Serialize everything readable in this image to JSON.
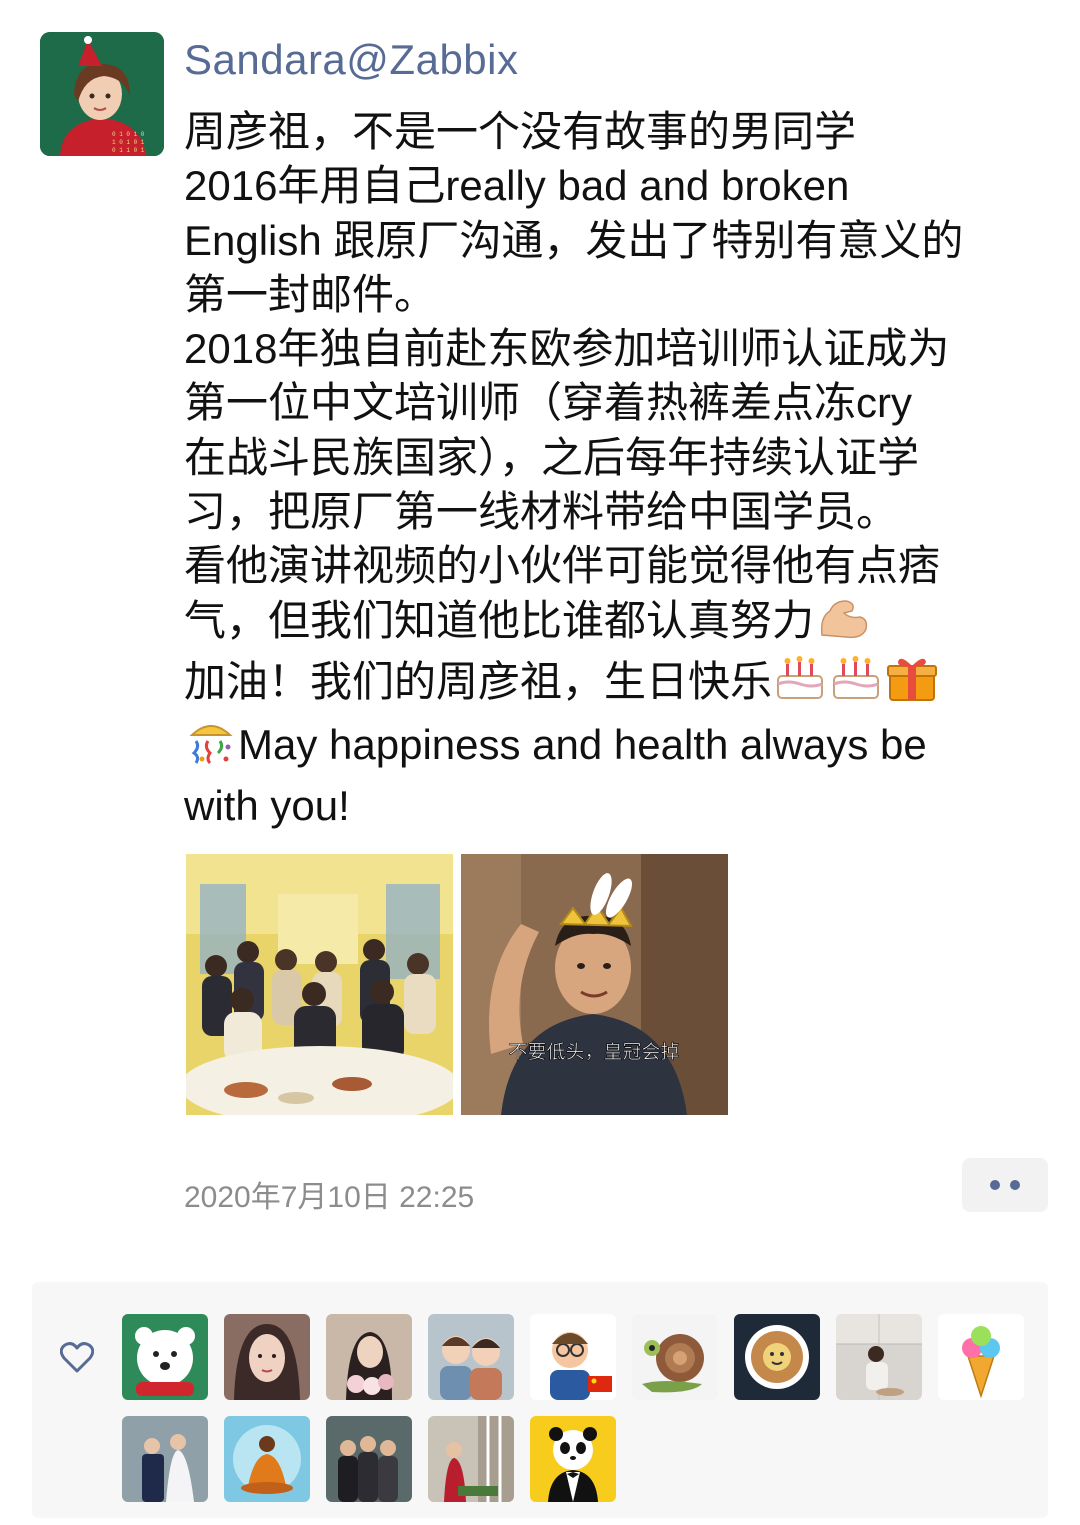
{
  "post": {
    "username": "Sandara@Zabbix",
    "lines": [
      "周彦祖，不是一个没有故事的男同学",
      "2016年用自己really bad and broken",
      "English 跟原厂沟通，发出了特别有意义的",
      "第一封邮件。",
      "2018年独自前赴东欧参加培训师认证成为",
      "第一位中文培训师（穿着热裤差点冻cry",
      "在战斗民族国家），之后每年持续认证学",
      "习，把原厂第一线材料带给中国学员。",
      "看他演讲视频的小伙伴可能觉得他有点痞",
      "气，但我们知道他比谁都认真努力",
      "加油！我们的周彦祖，生日快乐",
      "May happiness and health always be",
      "with you!"
    ],
    "photo2_caption": "不要低头，皇冠会掉",
    "timestamp": "2020年7月10日 22:25"
  },
  "icons": {
    "avatar": "girl-avatar-icon",
    "muscle": "flexed-biceps-icon",
    "cake": "birthday-cake-icon",
    "gift": "gift-icon",
    "party": "party-popper-icon",
    "more": "more-dots-icon",
    "like": "heart-outline-icon"
  },
  "colors": {
    "username": "#576b95",
    "text": "#111111",
    "timestamp": "#8c8c8c",
    "panel_bg": "#f7f7f7"
  },
  "likers": [
    "polar-bear-avatar",
    "illustrated-girl-avatar",
    "flowers-portrait-avatar",
    "two-kids-avatar",
    "cartoon-man-flag-avatar",
    "snail-avatar",
    "coffee-art-avatar",
    "mirror-selfie-avatar",
    "ice-cream-avatar",
    "wedding-couple-avatar",
    "meditation-silhouette-avatar",
    "group-photo-avatar",
    "street-portrait-avatar",
    "panda-tuxedo-avatar"
  ]
}
